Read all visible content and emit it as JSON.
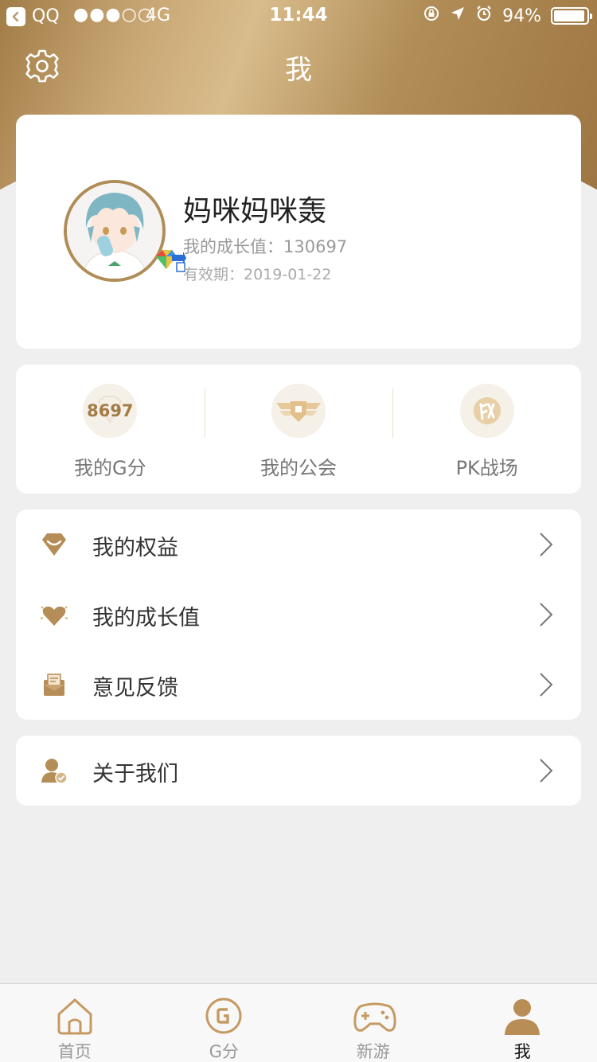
{
  "status_bar": {
    "back_app": "QQ",
    "signal": "●●●○○",
    "network": "4G",
    "time": "11:44",
    "battery": "94%",
    "battery_level": 0.94
  },
  "nav": {
    "title": "我"
  },
  "profile": {
    "name": "妈咪妈咪轰",
    "growth_value": "我的成长值：130697",
    "valid_until": "有效期：2019-01-22"
  },
  "quick_items": [
    {
      "value": "8697",
      "label": "我的G分",
      "icon": "diamond-icon"
    },
    {
      "label": "我的公会",
      "icon": "guild-wings-icon"
    },
    {
      "label": "PK战场",
      "icon": "battle-icon"
    }
  ],
  "menu": [
    {
      "label": "我的权益",
      "icon": "rights-gem-icon"
    },
    {
      "label": "我的成长值",
      "icon": "growth-heart-icon"
    },
    {
      "label": "意见反馈",
      "icon": "feedback-envelope-icon"
    }
  ],
  "about": {
    "label": "关于我们",
    "icon": "user-check-icon"
  },
  "tabbar": [
    {
      "label": "首页",
      "icon": "home-icon",
      "active": false
    },
    {
      "label": "G分",
      "icon": "g-coin-icon",
      "active": false
    },
    {
      "label": "新游",
      "icon": "gamepad-icon",
      "active": false
    },
    {
      "label": "我",
      "icon": "person-icon",
      "active": true
    }
  ],
  "colors": {
    "accent_gold": "#a37b45",
    "background": "#efefef",
    "card": "#ffffff"
  }
}
